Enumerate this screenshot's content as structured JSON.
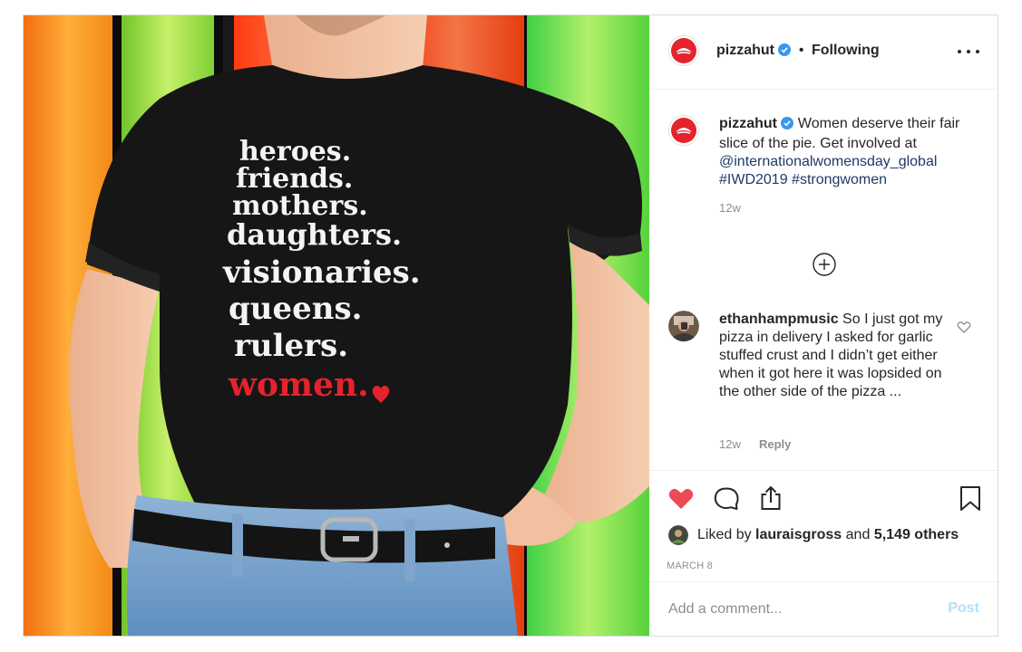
{
  "post": {
    "photo": {
      "shirt_lines": [
        "heroes.",
        "friends.",
        "mothers.",
        "daughters.",
        "visionaries.",
        "queens.",
        "rulers.",
        "women."
      ],
      "backdrop_colors": [
        "#f7941d",
        "#8cd23c",
        "#ff4a1a",
        "#6ee044",
        "#2bd44b"
      ],
      "shirt_color": "#161616",
      "accent_red": "#e4232d"
    },
    "header": {
      "username": "pizzahut",
      "verified_icon": "verified-badge-icon",
      "separator": "•",
      "follow_state": "Following",
      "more_icon": "more-options-icon"
    },
    "caption": {
      "username": "pizzahut",
      "text": "Women deserve their fair slice of the pie. Get involved at",
      "mention": "@internationalwomensday_global",
      "hashtag1": "#IWD2019",
      "hashtag2": "#strongwomen",
      "age": "12w"
    },
    "load_more_icon": "plus-circle-icon",
    "comments": [
      {
        "username": "ethanhampmusic",
        "text": "So I just got my pizza in delivery I asked for garlic stuffed crust and I didn’t get either when it got here it was lopsided on the other side of the pizza ...",
        "age": "12w",
        "reply_label": "Reply"
      }
    ],
    "actions": {
      "like_icon": "heart-filled-icon",
      "comment_icon": "comment-icon",
      "share_icon": "share-icon",
      "save_icon": "bookmark-icon",
      "liked": true
    },
    "likes": {
      "prefix": "Liked by",
      "user": "lauraisgross",
      "joiner": "and",
      "others": "5,149 others"
    },
    "date": "MARCH 8",
    "add_comment": {
      "placeholder": "Add a comment...",
      "post_label": "Post"
    },
    "colors": {
      "brand_red": "#e4232d",
      "link": "#1f3a66",
      "muted": "#8e8e8e",
      "verified_blue": "#3897f0",
      "post_disabled": "#b2dffc"
    }
  }
}
